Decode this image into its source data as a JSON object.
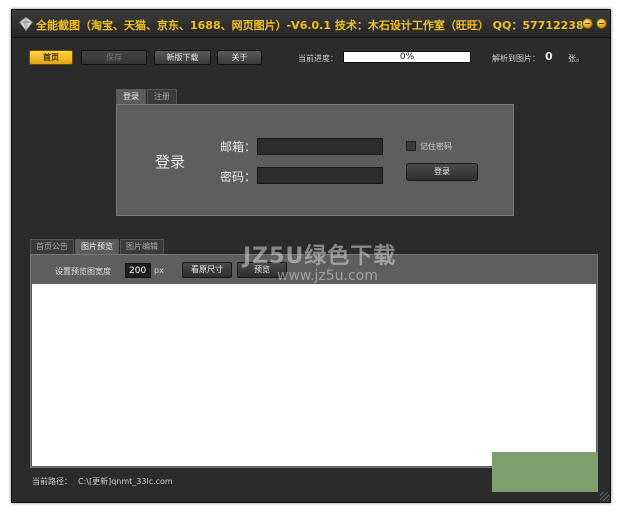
{
  "window": {
    "title": "全能截图（淘宝、天猫、京东、1688、网页图片）-V6.0.1  技术：木石设计工作室（旺旺）  QQ：577122380"
  },
  "toolbar": {
    "home_label": "首页",
    "save_label": "保存",
    "new_download_label": "新版下载",
    "about_label": "关于",
    "progress_label": "当前进度：",
    "progress_value": "0%",
    "progress_fraction": 0,
    "parsed_label": "解析到图片：",
    "parsed_count": "0",
    "parsed_unit": "张。"
  },
  "login": {
    "tabs": [
      "登录",
      "注册"
    ],
    "title": "登录",
    "email_label": "邮箱：",
    "email_value": "",
    "password_label": "密码：",
    "password_value": "",
    "remember_label": "记住密码",
    "remember_checked": false,
    "login_button": "登录"
  },
  "preview": {
    "tabs": [
      "首页公告",
      "图片预览",
      "图片编辑"
    ],
    "active_tab": 1,
    "width_label": "设置预览图宽度",
    "width_value": "200",
    "px_label": "px",
    "original_size_button": "看原尺寸",
    "preview_button": "预览"
  },
  "status": {
    "path_label": "当前路径：",
    "path_value": "C:\\[更新]qnmt_33lc.com"
  },
  "watermark": {
    "line1": "JZ5U绿色下载",
    "line2": "www.jz5u.com"
  },
  "colors": {
    "accent": "#f0c020",
    "window_bg": "#2b2b2b",
    "panel_bg": "#5e5e5e",
    "active_button": "#ffd44a"
  }
}
